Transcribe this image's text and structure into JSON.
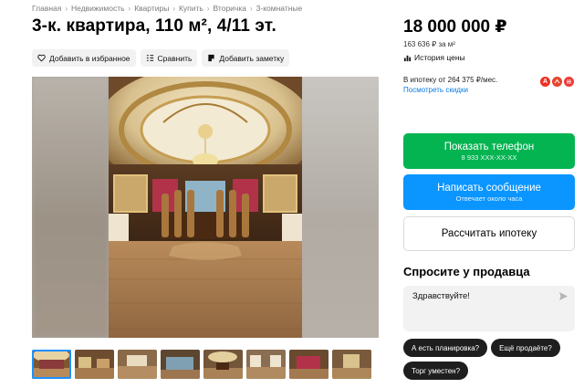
{
  "breadcrumb": [
    "Главная",
    "Недвижимость",
    "Квартиры",
    "Купить",
    "Вторичка",
    "3-комнатные"
  ],
  "listing": {
    "title": "3-к. квартира, 110 м², 4/11 эт."
  },
  "actions": {
    "favorite": "Добавить в избранное",
    "compare": "Сравнить",
    "note": "Добавить заметку"
  },
  "gallery": {
    "thumbnail_count": 8,
    "active_index": 0
  },
  "price": {
    "value": "18 000 000 ₽",
    "per_sqm": "163 636 ₽ за м²",
    "history": "История цены"
  },
  "mortgage": {
    "monthly": "В ипотеку от 264 375 ₽/мес.",
    "discounts_link": "Посмотреть скидки",
    "banks": [
      {
        "letter": "А",
        "color": "#ef3124"
      },
      {
        "letter": "",
        "color": "#e4452f"
      },
      {
        "letter": "",
        "color": "#f03a3a"
      }
    ]
  },
  "buttons": {
    "show_phone": "Показать телефон",
    "phone_masked": "8 933 XXX-XX-XX",
    "write_message": "Написать сообщение",
    "reply_time": "Отвечает около часа",
    "calc_mortgage": "Рассчитать ипотеку"
  },
  "ask_seller": {
    "title": "Спросите у продавца",
    "message": "Здравствуйте!",
    "chips": [
      "А есть планировка?",
      "Ещё продаёте?",
      "Торг уместен?"
    ]
  },
  "colors": {
    "green": "#04b451",
    "blue": "#0a95ff",
    "link": "#0a7be6"
  }
}
